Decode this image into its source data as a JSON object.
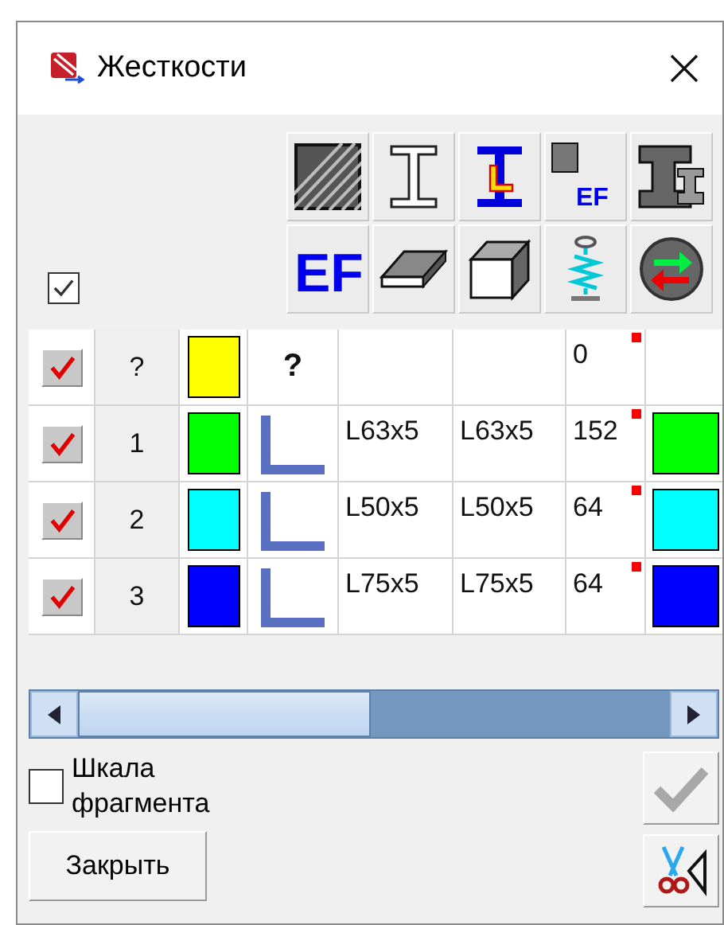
{
  "window": {
    "title": "Жесткости"
  },
  "show_all": {
    "checked": true
  },
  "toolbar": [
    {
      "kind": "hatch"
    },
    {
      "kind": "ibeam"
    },
    {
      "kind": "ibeam-angle"
    },
    {
      "kind": "plate-ef",
      "label": "EF"
    },
    {
      "kind": "profile"
    },
    {
      "kind": "ef",
      "label": "EF"
    },
    {
      "kind": "plate"
    },
    {
      "kind": "box"
    },
    {
      "kind": "spring"
    },
    {
      "kind": "swap"
    }
  ],
  "rows": [
    {
      "checked": true,
      "number": "?",
      "color": "#ffff00",
      "section": {
        "kind": "text",
        "text": "?"
      },
      "col_7": "0",
      "marked": true
    },
    {
      "checked": true,
      "number": "1",
      "color": "#00ff00",
      "section": {
        "kind": "angle"
      },
      "col_5": "L63x5",
      "col_6": "L63x5",
      "col_7": "152",
      "marked": true,
      "swatch_2": {
        "color": "#00ff00"
      }
    },
    {
      "checked": true,
      "number": "2",
      "color": "#00ffff",
      "section": {
        "kind": "angle"
      },
      "col_5": "L50x5",
      "col_6": "L50x5",
      "col_7": "64",
      "marked": true,
      "swatch_2": {
        "color": "#00ffff"
      }
    },
    {
      "checked": true,
      "number": "3",
      "color": "#0000ff",
      "section": {
        "kind": "angle"
      },
      "col_5": "L75x5",
      "col_6": "L75x5",
      "col_7": "64",
      "marked": true,
      "swatch_2": {
        "color": "#0000ff"
      }
    }
  ],
  "fragment_scale": {
    "label": "Шкала фрагмента",
    "checked": false
  },
  "apply_button": {
    "disabled": true
  },
  "close_button": {
    "label": "Закрыть"
  }
}
